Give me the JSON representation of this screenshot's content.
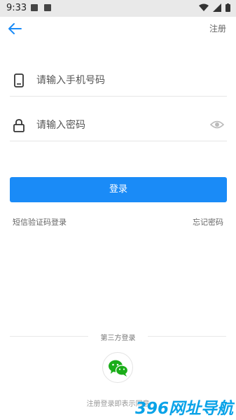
{
  "status_bar": {
    "time": "9:33"
  },
  "header": {
    "register_label": "注册"
  },
  "phone_field": {
    "placeholder": "请输入手机号码"
  },
  "password_field": {
    "placeholder": "请输入密码"
  },
  "login_button": {
    "label": "登录"
  },
  "links": {
    "sms_login": "短信验证码登录",
    "forgot_password": "忘记密码"
  },
  "third_party": {
    "title": "第三方登录",
    "wechat_icon": "wechat-icon"
  },
  "footer": {
    "agreement": "注册登录即表示同意"
  },
  "watermark": {
    "text": "396网址导航"
  },
  "colors": {
    "accent": "#1a8bf7",
    "wechat_green": "#1aad19"
  }
}
